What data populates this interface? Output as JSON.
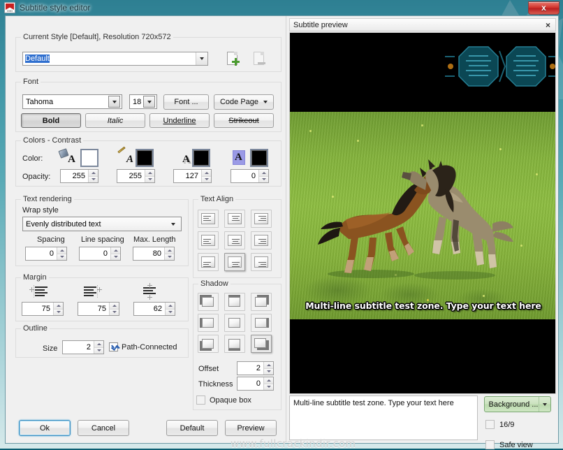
{
  "window": {
    "title": "Subtitle style editor",
    "close_label": "x",
    "app_icon": "dvd-app-icon"
  },
  "current_style": {
    "group_title": "Current Style [Default], Resolution 720x572",
    "selected": "Default",
    "add_icon": "add-style-icon",
    "remove_icon": "remove-style-icon"
  },
  "font": {
    "group_title": "Font",
    "family": "Tahoma",
    "size": "18",
    "font_button": "Font ...",
    "code_page_button": "Code Page",
    "bold": "Bold",
    "italic": "Italic",
    "underline": "Underline",
    "strikeout": "Strikeout"
  },
  "colors": {
    "group_title": "Colors - Contrast",
    "color_label": "Color:",
    "opacity_label": "Opacity:",
    "swatches": [
      {
        "name": "fill-color",
        "hex": "#ffffff",
        "opacity": "255",
        "glyph": "bucket-a-icon"
      },
      {
        "name": "outline-color",
        "hex": "#000000",
        "opacity": "255",
        "glyph": "pen-a-icon"
      },
      {
        "name": "shadow-color",
        "hex": "#000000",
        "opacity": "127",
        "glyph": "shadow-a-icon"
      },
      {
        "name": "background-color",
        "hex": "#000000",
        "opacity": "0",
        "glyph": "highlight-a-icon"
      }
    ]
  },
  "text_rendering": {
    "group_title": "Text rendering",
    "wrap_style_label": "Wrap style",
    "wrap_style_value": "Evenly distributed text",
    "spacing_label": "Spacing",
    "spacing_value": "0",
    "line_spacing_label": "Line spacing",
    "line_spacing_value": "0",
    "max_length_label": "Max. Length",
    "max_length_value": "80"
  },
  "margin": {
    "group_title": "Margin",
    "left_value": "75",
    "right_value": "75",
    "vertical_value": "62"
  },
  "outline": {
    "group_title": "Outline",
    "size_label": "Size",
    "size_value": "2",
    "path_connected_label": "Path-Connected",
    "path_connected_checked": true
  },
  "text_align": {
    "group_title": "Text Align",
    "selected_index": 7
  },
  "shadow": {
    "group_title": "Shadow",
    "selected_index": 8,
    "offset_label": "Offset",
    "offset_value": "2",
    "thickness_label": "Thickness",
    "thickness_value": "0",
    "opaque_box_label": "Opaque box",
    "opaque_box_checked": false
  },
  "dialog_buttons": {
    "ok": "Ok",
    "cancel": "Cancel",
    "default": "Default",
    "preview": "Preview"
  },
  "preview": {
    "panel_title": "Subtitle preview",
    "close_label": "×",
    "subtitle_overlay": "Multi-line subtitle test zone. Type your text here",
    "subtitle_edit_value": "Multi-line subtitle test zone. Type your text here",
    "background_button": "Background ...",
    "aspect_16_9_label": "16/9",
    "aspect_16_9_checked": false,
    "safe_view_label": "Safe view",
    "safe_view_checked": false
  },
  "watermark": "www.fullcrackindir.com",
  "colors_theme": {
    "title_gradient_top": "#2e7f92",
    "title_gradient_bottom": "#d6e9ea",
    "client_bg": "#f0f0f0",
    "accent_button_green": "#cbe3bf",
    "selection_blue": "#2f6fcf"
  }
}
